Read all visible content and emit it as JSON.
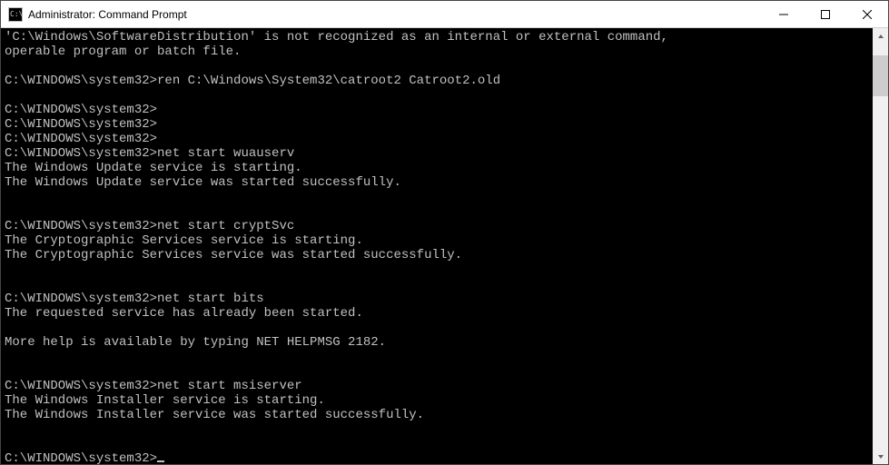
{
  "window": {
    "title": "Administrator: Command Prompt"
  },
  "scrollbar": {
    "thumb_top_pct": 3,
    "thumb_height_pct": 10
  },
  "console": {
    "prompt": "C:\\WINDOWS\\system32>",
    "lines": [
      "'C:\\Windows\\SoftwareDistribution' is not recognized as an internal or external command,",
      "operable program or batch file.",
      "",
      "C:\\WINDOWS\\system32>ren C:\\Windows\\System32\\catroot2 Catroot2.old",
      "",
      "C:\\WINDOWS\\system32>",
      "C:\\WINDOWS\\system32>",
      "C:\\WINDOWS\\system32>",
      "C:\\WINDOWS\\system32>net start wuauserv",
      "The Windows Update service is starting.",
      "The Windows Update service was started successfully.",
      "",
      "",
      "C:\\WINDOWS\\system32>net start cryptSvc",
      "The Cryptographic Services service is starting.",
      "The Cryptographic Services service was started successfully.",
      "",
      "",
      "C:\\WINDOWS\\system32>net start bits",
      "The requested service has already been started.",
      "",
      "More help is available by typing NET HELPMSG 2182.",
      "",
      "",
      "C:\\WINDOWS\\system32>net start msiserver",
      "The Windows Installer service is starting.",
      "The Windows Installer service was started successfully.",
      "",
      "",
      "C:\\WINDOWS\\system32>"
    ]
  }
}
